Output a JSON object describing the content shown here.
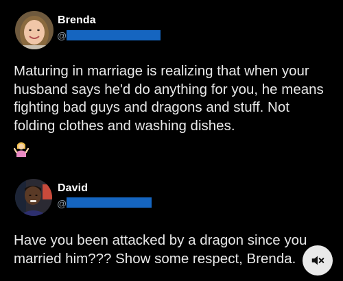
{
  "posts": [
    {
      "author": "Brenda",
      "handle_prefix": "@",
      "text": "Maturing in marriage is realizing that when your husband says he'd do anything for you, he means fighting bad guys and dragons and stuff. Not folding clothes and washing dishes.",
      "emoji": "woman-shrugging-icon"
    },
    {
      "author": "David",
      "handle_prefix": "@",
      "text": "Have you been attacked by a dragon since you married him??? Show some respect, Brenda."
    }
  ],
  "controls": {
    "sound_icon": "speaker-muted-icon"
  },
  "colors": {
    "background": "#000000",
    "text": "#e8e8e8",
    "handle_redaction": "#1565c0"
  }
}
